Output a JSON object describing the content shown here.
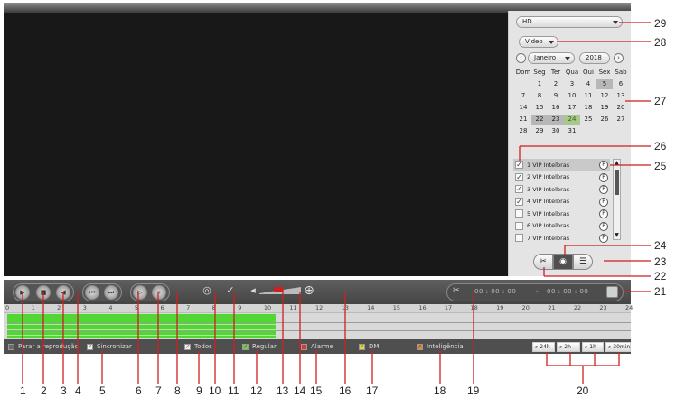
{
  "panel": {
    "quality": "HD",
    "stream_type": "Video",
    "calendar": {
      "month": "Janeiro",
      "year": "2018",
      "weekdays": [
        "Dom",
        "Seg",
        "Ter",
        "Qua",
        "Qui",
        "Sex",
        "Sab"
      ],
      "weeks": [
        [
          "",
          "1",
          "2",
          "3",
          "4",
          "5",
          "6"
        ],
        [
          "7",
          "8",
          "9",
          "10",
          "11",
          "12",
          "13"
        ],
        [
          "14",
          "15",
          "16",
          "17",
          "18",
          "19",
          "20"
        ],
        [
          "21",
          "22",
          "23",
          "24",
          "25",
          "26",
          "27"
        ],
        [
          "28",
          "29",
          "30",
          "31",
          "",
          "",
          ""
        ]
      ],
      "highlighted_days": [
        "5",
        "22",
        "23"
      ],
      "recorded_days": [
        "24"
      ]
    },
    "channels": [
      {
        "label": "1 VIP Intelbras",
        "checked": true,
        "selected": true,
        "p": "P"
      },
      {
        "label": "2 VIP Intelbras",
        "checked": true,
        "selected": false,
        "p": "P"
      },
      {
        "label": "3 VIP Intelbras",
        "checked": true,
        "selected": false,
        "p": "P"
      },
      {
        "label": "4 VIP Intelbras",
        "checked": true,
        "selected": false,
        "p": "P"
      },
      {
        "label": "5 VIP Intelbras",
        "checked": false,
        "selected": false,
        "p": "P"
      },
      {
        "label": "6 VIP Intelbras",
        "checked": false,
        "selected": false,
        "p": "P"
      },
      {
        "label": "7 VIP Intelbras",
        "checked": false,
        "selected": false,
        "p": "P"
      }
    ]
  },
  "controls": {
    "time_start": "00 : 00 : 00",
    "time_separator": "-",
    "time_end": "00 : 00 : 00"
  },
  "timeline": {
    "hours": [
      "0",
      "1",
      "2",
      "3",
      "4",
      "5",
      "6",
      "7",
      "8",
      "9",
      "10",
      "11",
      "12",
      "13",
      "14",
      "15",
      "16",
      "17",
      "18",
      "19",
      "20",
      "21",
      "22",
      "23",
      "24"
    ],
    "recorded_fraction": 0.43
  },
  "legend": {
    "stop": "Parar a reprodução",
    "sync": "Sincronizar",
    "all": "Todos",
    "regular": "Regular",
    "alarm": "Alarme",
    "md": "DM",
    "intel": "Inteligência",
    "zoom": [
      "24h",
      "2h",
      "1h",
      "30min"
    ]
  },
  "annotations": {
    "bottom": [
      "1",
      "2",
      "3",
      "4",
      "5",
      "6",
      "7",
      "8",
      "9",
      "10",
      "11",
      "12",
      "13",
      "14",
      "15",
      "16",
      "17",
      "18",
      "19",
      "20"
    ],
    "right": [
      "29",
      "28",
      "27",
      "26",
      "25",
      "24",
      "23",
      "22",
      "21"
    ]
  },
  "colors": {
    "recording": "#52d633",
    "callout": "#d01f1f",
    "regular": "#6cd04a",
    "alarm": "#d93a2e",
    "md": "#e3d43a",
    "intel": "#e48a2e"
  }
}
